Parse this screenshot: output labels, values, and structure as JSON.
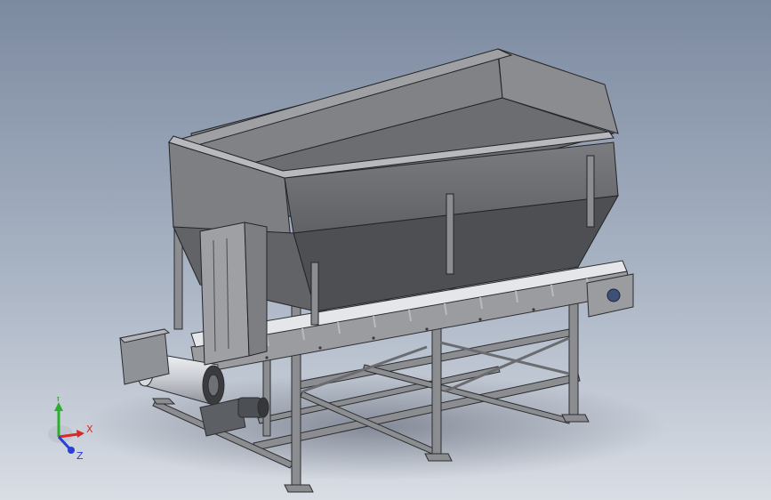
{
  "scene": {
    "background_top": "#7c8aa0",
    "background_bottom": "#d9dde4",
    "steel_color": "#8b8d90",
    "hopper_color": "#6f7174",
    "belt_color": "#e4e6ea"
  },
  "triad": {
    "x_label": "X",
    "y_label": "Y",
    "z_label": "Z",
    "x_color": "#d42a2a",
    "y_color": "#2bb02b",
    "z_color": "#2a3fd4"
  }
}
